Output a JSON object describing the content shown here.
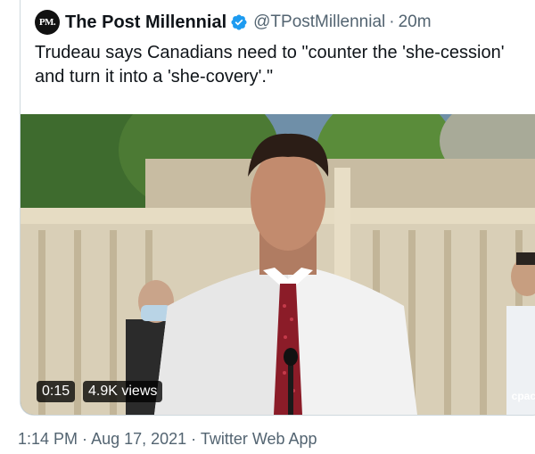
{
  "tweet": {
    "avatar_text": "PM.",
    "author_name": "The Post Millennial",
    "handle": "@TPostMillennial",
    "separator": "·",
    "relative_time": "20m",
    "text": "Trudeau says Canadians need to \"counter the 'she-cession' and turn it into a 'she-covery'.\"",
    "verified_color": "#1d9bf0"
  },
  "video": {
    "duration": "0:15",
    "views": "4.9K views",
    "watermark": "cpac"
  },
  "footer": {
    "time": "1:14 PM",
    "date": "Aug 17, 2021",
    "source": "Twitter Web App",
    "separator": "·"
  }
}
